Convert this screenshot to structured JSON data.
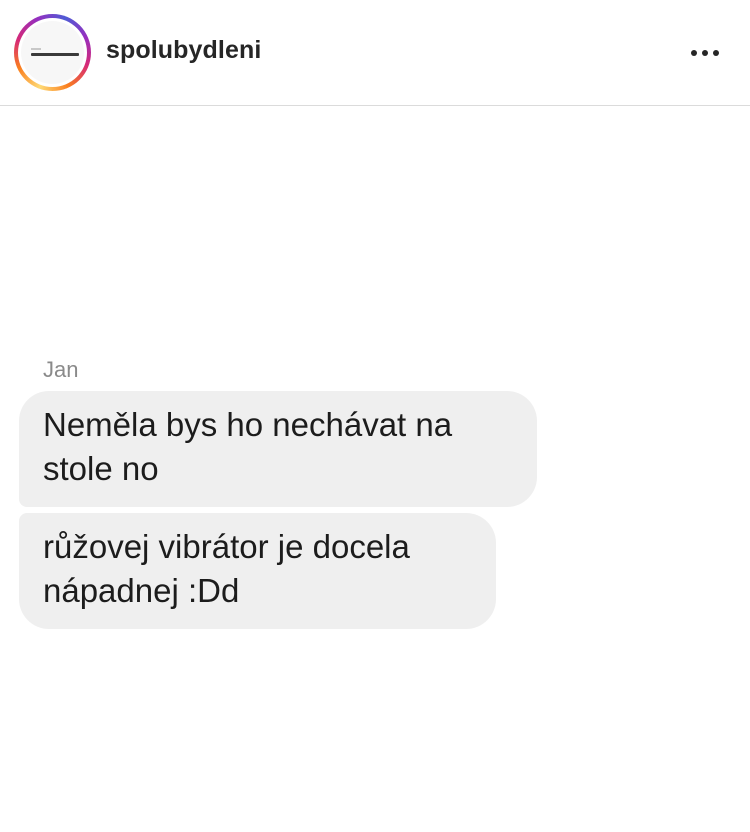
{
  "header": {
    "username": "spolubydleni",
    "more_icon": "more-horizontal-icon"
  },
  "chat": {
    "sender": "Jan",
    "messages": [
      {
        "line1": "Neměla bys ho nechávat na",
        "line2": "stole no"
      },
      {
        "line1": "růžovej vibrátor je docela",
        "line2": "nápadnej :Dd"
      }
    ]
  },
  "colors": {
    "bubble": "#efefef",
    "text": "#262626",
    "sender": "#8a8a8a",
    "divider": "#dbdbdb"
  }
}
